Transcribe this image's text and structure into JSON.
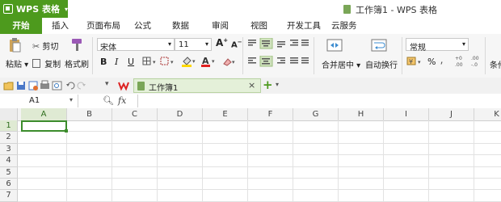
{
  "app": {
    "button_label": "WPS 表格",
    "window_title": "工作簿1 - WPS 表格"
  },
  "menu": {
    "tabs": [
      "开始",
      "插入",
      "页面布局",
      "公式",
      "数据",
      "审阅",
      "视图",
      "开发工具",
      "云服务"
    ]
  },
  "ribbon": {
    "paste": "粘贴",
    "cut": "剪切",
    "copy": "复制",
    "format_painter": "格式刷",
    "font_name": "宋体",
    "font_size": "11",
    "bold": "B",
    "italic": "I",
    "underline": "U",
    "merge_center": "合并居中",
    "wrap_text": "自动换行",
    "number_format": "常规",
    "percent": "%",
    "thousands": "",
    "cond_format": "条件"
  },
  "quick_access": {
    "file_tab": "工作簿1"
  },
  "formula_bar": {
    "name_box": "A1",
    "fx": "fx",
    "formula": ""
  },
  "grid": {
    "columns": [
      "A",
      "B",
      "C",
      "D",
      "E",
      "F",
      "G",
      "H",
      "I",
      "J",
      "K"
    ],
    "rows": [
      "1",
      "2",
      "3",
      "4",
      "5",
      "6",
      "7"
    ],
    "selected_cell": "A1"
  },
  "colors": {
    "accent": "#4d9a1d",
    "selection": "#3c8c2c"
  }
}
